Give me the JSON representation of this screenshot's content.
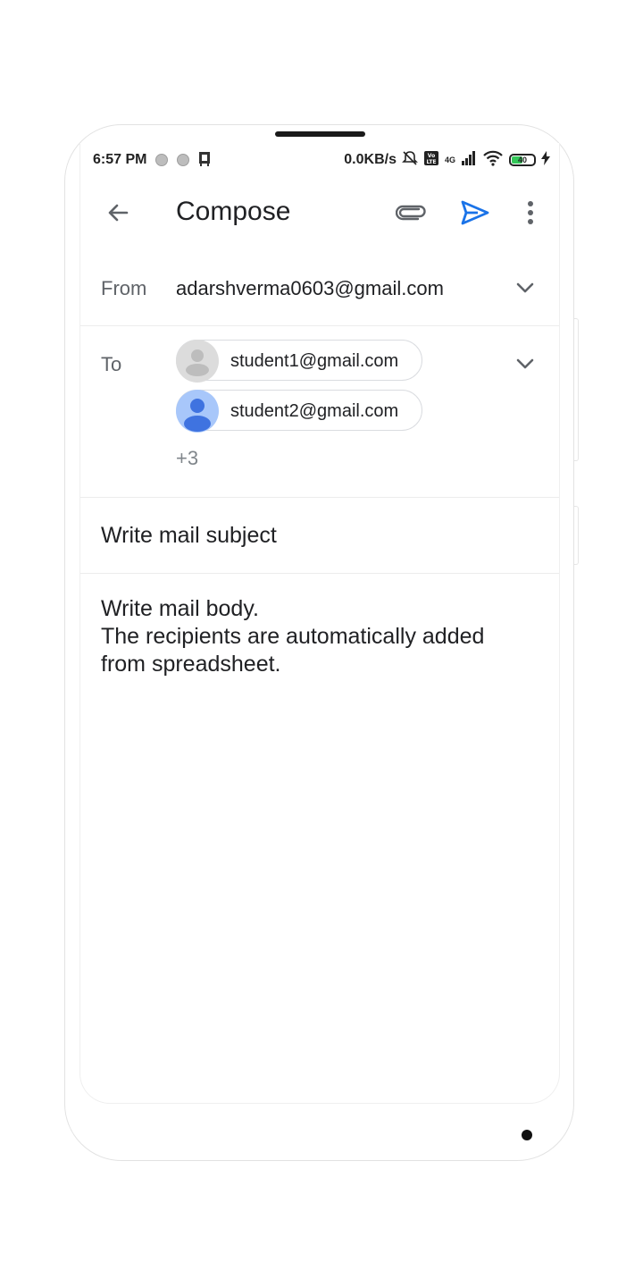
{
  "status_bar": {
    "time": "6:57 PM",
    "speed": "0.0KB/s",
    "network": "4G",
    "battery": "40"
  },
  "appbar": {
    "title": "Compose",
    "icons": [
      "back-arrow-icon",
      "attachment-icon",
      "send-icon",
      "more-vert-icon"
    ],
    "accent_color": "#1a73e8"
  },
  "from": {
    "label": "From",
    "value": "adarshverma0603@gmail.com"
  },
  "to": {
    "label": "To",
    "recipients": [
      {
        "email": "student1@gmail.com"
      },
      {
        "email": "student2@gmail.com"
      }
    ],
    "more_count": "+3"
  },
  "subject": {
    "value": "Write mail subject"
  },
  "body": {
    "lines": [
      "Write mail body.",
      "The recipients are automatically added",
      "from spreadsheet."
    ]
  }
}
